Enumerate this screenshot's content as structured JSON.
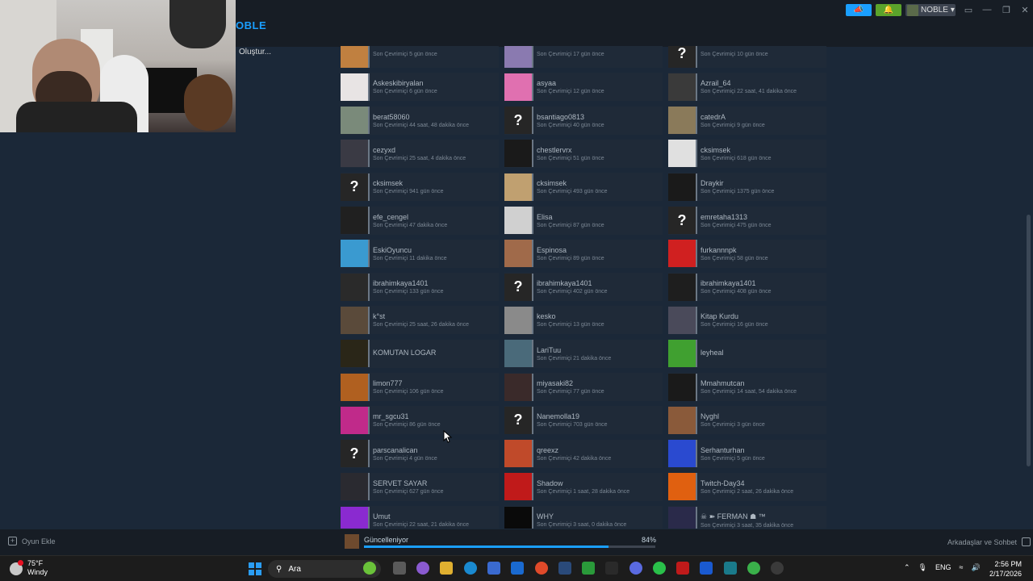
{
  "header": {
    "username_partial": "OBLE",
    "create_link": "Oluştur...",
    "account_name": "NOBLE",
    "account_caret": "▾"
  },
  "colors": {
    "background": "#1b2838",
    "accent": "#1a9fff",
    "notify_green": "#5ba32b",
    "offline_strip": "#6b7785"
  },
  "icons": {
    "announce": "megaphone-icon",
    "notify": "bell-icon",
    "minimize": "minimize-icon",
    "restore": "restore-icon",
    "close": "close-icon"
  },
  "friends": {
    "columns": [
      [
        {
          "name": "",
          "status": "Son Çevrimiçi 5 gün önce",
          "avatar": "#c08040",
          "unknown": false
        },
        {
          "name": "Askeskibiryalan",
          "status": "Son Çevrimiçi 6 gün önce",
          "avatar": "#e8e4e4",
          "unknown": false
        },
        {
          "name": "berat58060",
          "status": "Son Çevrimiçi 44 saat, 48 dakika önce",
          "avatar": "#7a8a7a",
          "unknown": false
        },
        {
          "name": "cezyxd",
          "status": "Son Çevrimiçi 25 saat, 4 dakika önce",
          "avatar": "#3a3a44",
          "unknown": false
        },
        {
          "name": "cksimsek",
          "status": "Son Çevrimiçi 941 gün önce",
          "avatar": "#262626",
          "unknown": true
        },
        {
          "name": "efe_cengel",
          "status": "Son Çevrimiçi 47 dakika önce",
          "avatar": "#202020",
          "unknown": false
        },
        {
          "name": "EskiOyuncu",
          "status": "Son Çevrimiçi 11 dakika önce",
          "avatar": "#3a9ad0",
          "unknown": false
        },
        {
          "name": "ibrahimkaya1401",
          "status": "Son Çevrimiçi 133 gün önce",
          "avatar": "#2a2a2a",
          "unknown": false
        },
        {
          "name": "k°st",
          "status": "Son Çevrimiçi 25 saat, 26 dakika önce",
          "avatar": "#5a4a3a",
          "unknown": false
        },
        {
          "name": "KOMUTAN LOGAR",
          "status": "",
          "avatar": "#2a2618",
          "unknown": false
        },
        {
          "name": "limon777",
          "status": "Son Çevrimiçi 106 gün önce",
          "avatar": "#b06020",
          "unknown": false
        },
        {
          "name": "mr_sgcu31",
          "status": "Son Çevrimiçi 86 gün önce",
          "avatar": "#c02a8a",
          "unknown": false
        },
        {
          "name": "parscanalican",
          "status": "Son Çevrimiçi 4 gün önce",
          "avatar": "#262626",
          "unknown": true
        },
        {
          "name": "SERVET SAYAR",
          "status": "Son Çevrimiçi 627 gün önce",
          "avatar": "#2a2a30",
          "unknown": false
        },
        {
          "name": "Umut",
          "status": "Son Çevrimiçi 22 saat, 21 dakika önce",
          "avatar": "#8a2ad0",
          "unknown": false
        }
      ],
      [
        {
          "name": "",
          "status": "Son Çevrimiçi 17 gün önce",
          "avatar": "#8a7ab0",
          "unknown": false
        },
        {
          "name": "asyaa",
          "status": "Son Çevrimiçi 12 gün önce",
          "avatar": "#e070b0",
          "unknown": false
        },
        {
          "name": "bsantiago0813",
          "status": "Son Çevrimiçi 40 gün önce",
          "avatar": "#262626",
          "unknown": true
        },
        {
          "name": "chestlervrx",
          "status": "Son Çevrimiçi 51 gün önce",
          "avatar": "#1a1a1a",
          "unknown": false
        },
        {
          "name": "cksimsek",
          "status": "Son Çevrimiçi 493 gün önce",
          "avatar": "#c0a070",
          "unknown": false
        },
        {
          "name": "Elisa",
          "status": "Son Çevrimiçi 87 gün önce",
          "avatar": "#d0d0d0",
          "unknown": false
        },
        {
          "name": "Espinosa",
          "status": "Son Çevrimiçi 89 gün önce",
          "avatar": "#a06a4a",
          "unknown": false
        },
        {
          "name": "ibrahimkaya1401",
          "status": "Son Çevrimiçi 402 gün önce",
          "avatar": "#262626",
          "unknown": true
        },
        {
          "name": "kesko",
          "status": "Son Çevrimiçi 13 gün önce",
          "avatar": "#8a8a8a",
          "unknown": false
        },
        {
          "name": "LariTuu",
          "status": "Son Çevrimiçi 21 dakika önce",
          "avatar": "#4a6a7a",
          "unknown": false
        },
        {
          "name": "miyasaki82",
          "status": "Son Çevrimiçi 77 gün önce",
          "avatar": "#3a2a2a",
          "unknown": false
        },
        {
          "name": "Nanemolla19",
          "status": "Son Çevrimiçi 703 gün önce",
          "avatar": "#262626",
          "unknown": true
        },
        {
          "name": "qreexz",
          "status": "Son Çevrimiçi 42 dakika önce",
          "avatar": "#c04a2a",
          "unknown": false
        },
        {
          "name": "Shadow",
          "status": "Son Çevrimiçi 1 saat, 28 dakika önce",
          "avatar": "#c01a1a",
          "unknown": false
        },
        {
          "name": "WHY",
          "status": "Son Çevrimiçi 3 saat, 0 dakika önce",
          "avatar": "#0a0a0a",
          "unknown": false
        }
      ],
      [
        {
          "name": "",
          "status": "Son Çevrimiçi 10 gün önce",
          "avatar": "#262626",
          "unknown": true
        },
        {
          "name": "Azrail_64",
          "status": "Son Çevrimiçi 22 saat, 41 dakika önce",
          "avatar": "#3a3a3a",
          "unknown": false
        },
        {
          "name": "catedrA",
          "status": "Son Çevrimiçi 9 gün önce",
          "avatar": "#8a7a5a",
          "unknown": false
        },
        {
          "name": "cksimsek",
          "status": "Son Çevrimiçi 618 gün önce",
          "avatar": "#e0e0e0",
          "unknown": false
        },
        {
          "name": "Draykir",
          "status": "Son Çevrimiçi 1375 gün önce",
          "avatar": "#1a1a1a",
          "unknown": false
        },
        {
          "name": "emretaha1313",
          "status": "Son Çevrimiçi 475 gün önce",
          "avatar": "#262626",
          "unknown": true
        },
        {
          "name": "furkannnpk",
          "status": "Son Çevrimiçi 58 gün önce",
          "avatar": "#d02020",
          "unknown": false
        },
        {
          "name": "ibrahimkaya1401",
          "status": "Son Çevrimiçi 408 gün önce",
          "avatar": "#1e1e1e",
          "unknown": false
        },
        {
          "name": "Kitap Kurdu",
          "status": "Son Çevrimiçi 16 gün önce",
          "avatar": "#4a4a5a",
          "unknown": false
        },
        {
          "name": "leyheal",
          "status": "",
          "avatar": "#40a030",
          "unknown": false
        },
        {
          "name": "Mmahmutcan",
          "status": "Son Çevrimiçi 14 saat, 54 dakika önce",
          "avatar": "#1a1a1a",
          "unknown": false
        },
        {
          "name": "Nyghl",
          "status": "Son Çevrimiçi 3 gün önce",
          "avatar": "#8a5a3a",
          "unknown": false
        },
        {
          "name": "Serhanturhan",
          "status": "Son Çevrimiçi 5 gün önce",
          "avatar": "#2a4ad0",
          "unknown": false
        },
        {
          "name": "Twitch-Day34",
          "status": "Son Çevrimiçi 2 saat, 26 dakika önce",
          "avatar": "#e06010",
          "unknown": false
        },
        {
          "name": "☠ ➽ FERMAN ☗ ™",
          "status": "Son Çevrimiçi 3 saat, 35 dakika önce",
          "avatar": "#2a2a4a",
          "unknown": false
        }
      ]
    ]
  },
  "bottom": {
    "add_game": "Oyun Ekle",
    "update_label": "Güncelleniyor",
    "update_percent_text": "84%",
    "update_progress": 0.84,
    "friends_chat": "Arkadaşlar ve Sohbet"
  },
  "taskbar": {
    "temperature": "75°F",
    "weather": "Windy",
    "search": "Ara",
    "language": "ENG",
    "time": "2:56 PM",
    "date": "2/17/2026"
  }
}
